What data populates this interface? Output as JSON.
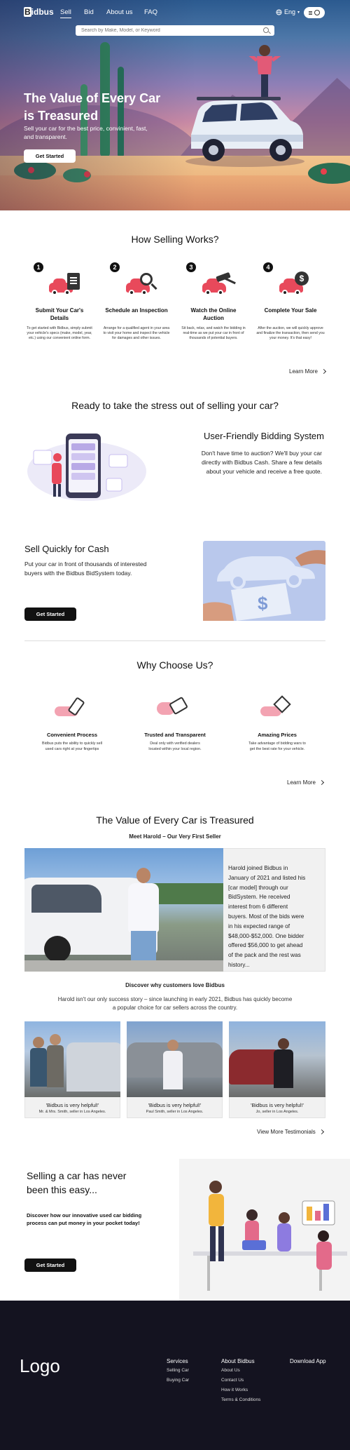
{
  "nav": {
    "logo": "Bidbus",
    "links": [
      "Sell",
      "Bid",
      "About us",
      "FAQ"
    ],
    "language": "Eng",
    "search_placeholder": "Search by Make, Model, or Keyword"
  },
  "hero": {
    "title": "The Value of Every Car is Treasured",
    "subtitle": "Sell your car for the best price, convinient, fast, and transparent.",
    "cta": "Get Started"
  },
  "how": {
    "title": "How Selling Works?",
    "steps": [
      {
        "num": "1",
        "title": "Submit Your Car's Details",
        "desc": "To get started with Bidbus, simply submit your vehicle's specs (make, model, year, etc.) using our convenient online form."
      },
      {
        "num": "2",
        "title": "Schedule an Inspection",
        "desc": "Arrange for a qualified agent in your area to visit your home and inspect the vehicle for damages and other issues."
      },
      {
        "num": "3",
        "title": "Watch the Online Auction",
        "desc": "Sit back, relax, and watch the bidding in real-time as we put your car in front of thousands of potential buyers."
      },
      {
        "num": "4",
        "title": "Complete Your Sale",
        "desc": "After the auction, we will quickly approve and finalize the transaction, then send you your money. It's that easy!"
      }
    ],
    "more": "Learn More"
  },
  "ready": {
    "title": "Ready to take the stress out of selling your car?",
    "feature_title": "User-Friendly Bidding System",
    "feature_text": "Don't have time to auction? We'll buy your car directly with Bidbus Cash. Share a few details about your vehicle and receive a free quote."
  },
  "cash": {
    "title": "Sell Quickly for Cash",
    "text": "Put your car in front of thousands of interested buyers with the Bidbus BidSystem today.",
    "cta": "Get Started"
  },
  "why": {
    "title": "Why Choose Us?",
    "items": [
      {
        "title": "Convenient Process",
        "desc": "Bidbus puts the ability to quickly sell used cars right at your fingertips"
      },
      {
        "title": "Trusted and Transparent",
        "desc": "Deal only with verified dealers located within your local region."
      },
      {
        "title": "Amazing Prices",
        "desc": "Take advantage of bidding wars to get the best rate for your vehicle."
      }
    ],
    "more": "Learn More"
  },
  "stories": {
    "title": "The Value of Every Car is Treasured",
    "subtitle": "Meet Harold – Our Very First Seller",
    "harold": "Harold joined Bidbus in January of 2021 and listed his [car model] through our BidSystem. He received interest from 6 different buyers. Most of the bids were in his expected range of $48,000-$52,000. One bidder offered $56,000 to get ahead of the pack and the rest was history...",
    "discover_title": "Discover why customers love Bidbus",
    "discover_text": "Harold isn't our only success story – since launching in early 2021, Bidbus has quickly become a popular choice for car sellers across the country.",
    "testimonials": [
      {
        "quote": "'Bidbus is very helpful!'",
        "by": "Mr. & Mrs. Smith, seller in Los Angeles."
      },
      {
        "quote": "'Bidbus is very helpful!'",
        "by": "Paul Smith, seller in Los Angeles."
      },
      {
        "quote": "'Bidbus is very helpful!'",
        "by": "Jo, seller in Los Angeles."
      }
    ],
    "more": "View More Testimonials"
  },
  "easy": {
    "title": "Selling a car has never been this easy...",
    "text": "Discover how our innovative used car bidding process can put money in your pocket today!",
    "cta": "Get Started"
  },
  "footer": {
    "logo": "Logo",
    "services_title": "Services",
    "services": [
      "Selling Car",
      "Buying Car"
    ],
    "about_title": "About Bidbus",
    "about": [
      "About Us",
      "Contact Us",
      "How it Works",
      "Terms & Conditions"
    ],
    "download_title": "Download App"
  },
  "colors": {
    "accent_red": "#e8495b",
    "dark": "#111111",
    "footer_bg": "#141320"
  }
}
